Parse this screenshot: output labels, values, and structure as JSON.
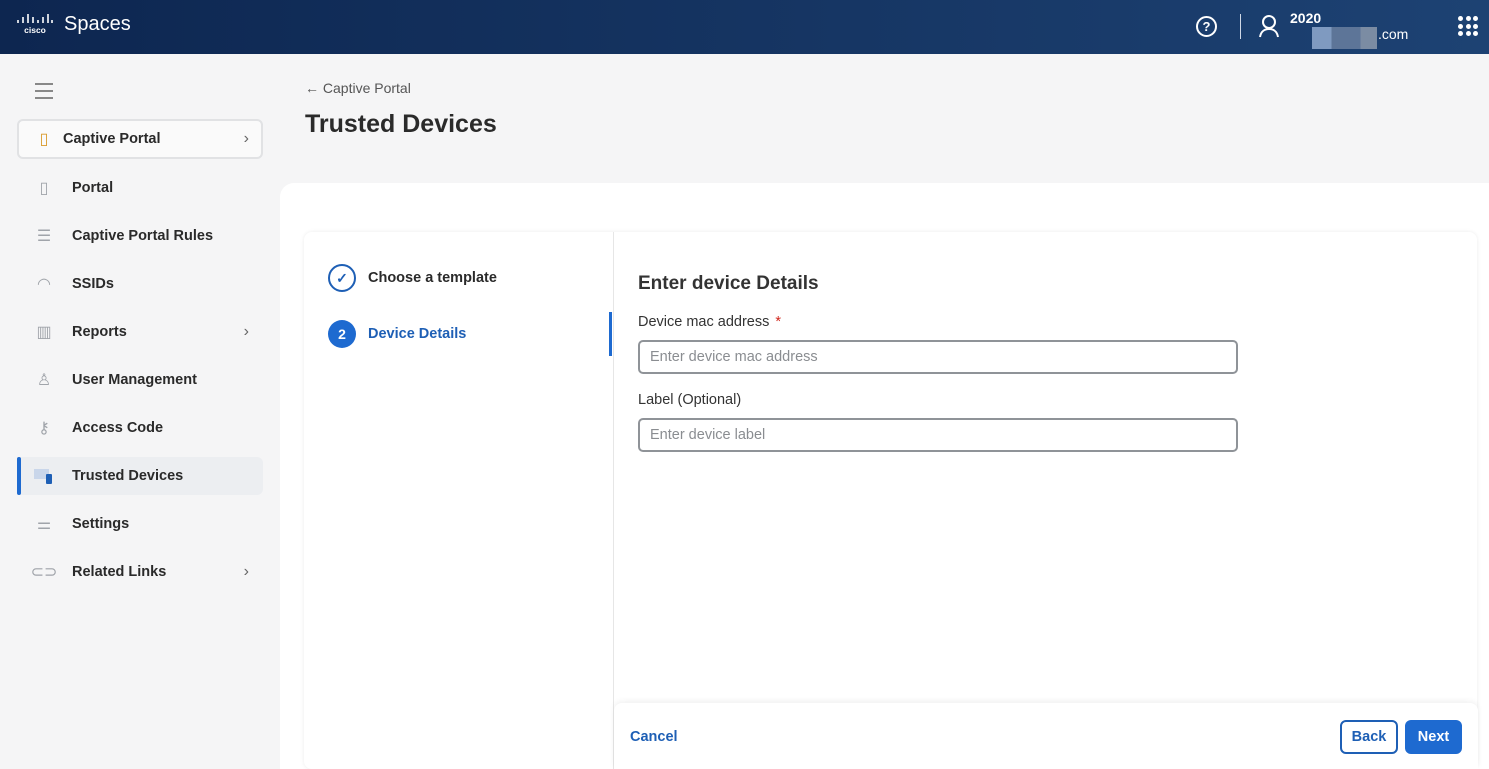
{
  "header": {
    "brand": "cisco",
    "app_name": "Spaces",
    "user_name": "2020",
    "user_domain": ".com",
    "help_icon": "?"
  },
  "sidebar": {
    "section": {
      "label": "Captive Portal"
    },
    "items": [
      {
        "label": "Portal",
        "icon": "phone-icon"
      },
      {
        "label": "Captive Portal Rules",
        "icon": "checklist-icon"
      },
      {
        "label": "SSIDs",
        "icon": "wifi-icon"
      },
      {
        "label": "Reports",
        "icon": "chart-icon",
        "has_children": true
      },
      {
        "label": "User Management",
        "icon": "user-icon"
      },
      {
        "label": "Access Code",
        "icon": "key-icon"
      },
      {
        "label": "Trusted Devices",
        "icon": "devices-icon",
        "active": true
      },
      {
        "label": "Settings",
        "icon": "sliders-icon"
      },
      {
        "label": "Related Links",
        "icon": "link-icon",
        "has_children": true
      }
    ]
  },
  "page": {
    "back_label": "Captive Portal",
    "back_arrow": "←",
    "title": "Trusted Devices"
  },
  "steps": [
    {
      "label": "Choose a template",
      "status": "done",
      "marker": "✓"
    },
    {
      "label": "Device Details",
      "status": "current",
      "marker": "2"
    }
  ],
  "form": {
    "title": "Enter device Details",
    "mac": {
      "label": "Device mac address",
      "required_mark": "*",
      "placeholder": "Enter device mac address",
      "value": ""
    },
    "label_field": {
      "label": "Label (Optional)",
      "placeholder": "Enter device label",
      "value": ""
    }
  },
  "footer": {
    "cancel": "Cancel",
    "back": "Back",
    "next": "Next"
  },
  "colors": {
    "accent": "#1e6ad0",
    "header": "#0d2650",
    "required": "#d0271d"
  }
}
